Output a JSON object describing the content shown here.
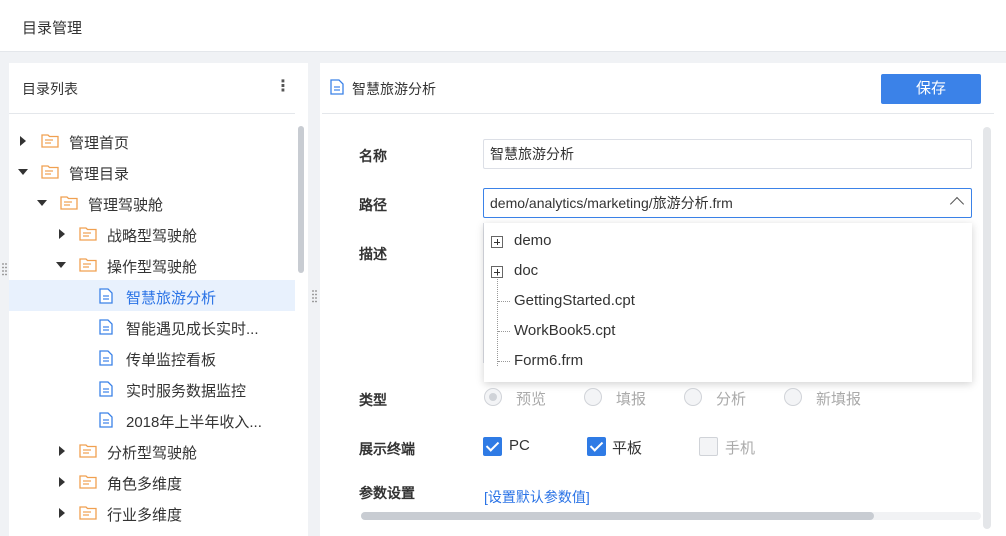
{
  "header": {
    "title": "目录管理"
  },
  "sidebar": {
    "title": "目录列表",
    "more_icon": "⋮",
    "items": [
      {
        "label": "管理首页",
        "type": "folder",
        "expander": "collapsed"
      },
      {
        "label": "管理目录",
        "type": "folder",
        "expander": "expanded"
      },
      {
        "label": "管理驾驶舱",
        "type": "folder",
        "expander": "expanded"
      },
      {
        "label": "战略型驾驶舱",
        "type": "folder",
        "expander": "collapsed"
      },
      {
        "label": "操作型驾驶舱",
        "type": "folder",
        "expander": "expanded"
      },
      {
        "label": "智慧旅游分析",
        "type": "doc",
        "selected": true
      },
      {
        "label": "智能遇见成长实时...",
        "type": "doc"
      },
      {
        "label": "传单监控看板",
        "type": "doc"
      },
      {
        "label": "实时服务数据监控",
        "type": "doc"
      },
      {
        "label": "2018年上半年收入...",
        "type": "doc"
      },
      {
        "label": "分析型驾驶舱",
        "type": "folder",
        "expander": "collapsed"
      },
      {
        "label": "角色多维度",
        "type": "folder",
        "expander": "collapsed"
      },
      {
        "label": "行业多维度",
        "type": "folder",
        "expander": "collapsed"
      }
    ]
  },
  "detail": {
    "title": "智慧旅游分析",
    "save_label": "保存",
    "name_label": "名称",
    "name_value": "智慧旅游分析",
    "path_label": "路径",
    "path_value": "demo/analytics/marketing/旅游分析.frm",
    "desc_label": "描述",
    "path_options": [
      {
        "label": "demo",
        "expandable": true
      },
      {
        "label": "doc",
        "expandable": true
      },
      {
        "label": "GettingStarted.cpt",
        "expandable": false
      },
      {
        "label": "WorkBook5.cpt",
        "expandable": false
      },
      {
        "label": "Form6.frm",
        "expandable": false
      }
    ],
    "type_label": "类型",
    "type_options": [
      "预览",
      "填报",
      "分析",
      "新填报"
    ],
    "type_selected": "预览",
    "terminal_label": "展示终端",
    "terminals": [
      {
        "label": "PC",
        "checked": true
      },
      {
        "label": "平板",
        "checked": true
      },
      {
        "label": "手机",
        "checked": false
      }
    ],
    "param_label": "参数设置",
    "param_link": "[设置默认参数值]"
  },
  "colors": {
    "accent": "#3b82e8",
    "folder": "#f0a050",
    "doc": "#3b82e8"
  }
}
